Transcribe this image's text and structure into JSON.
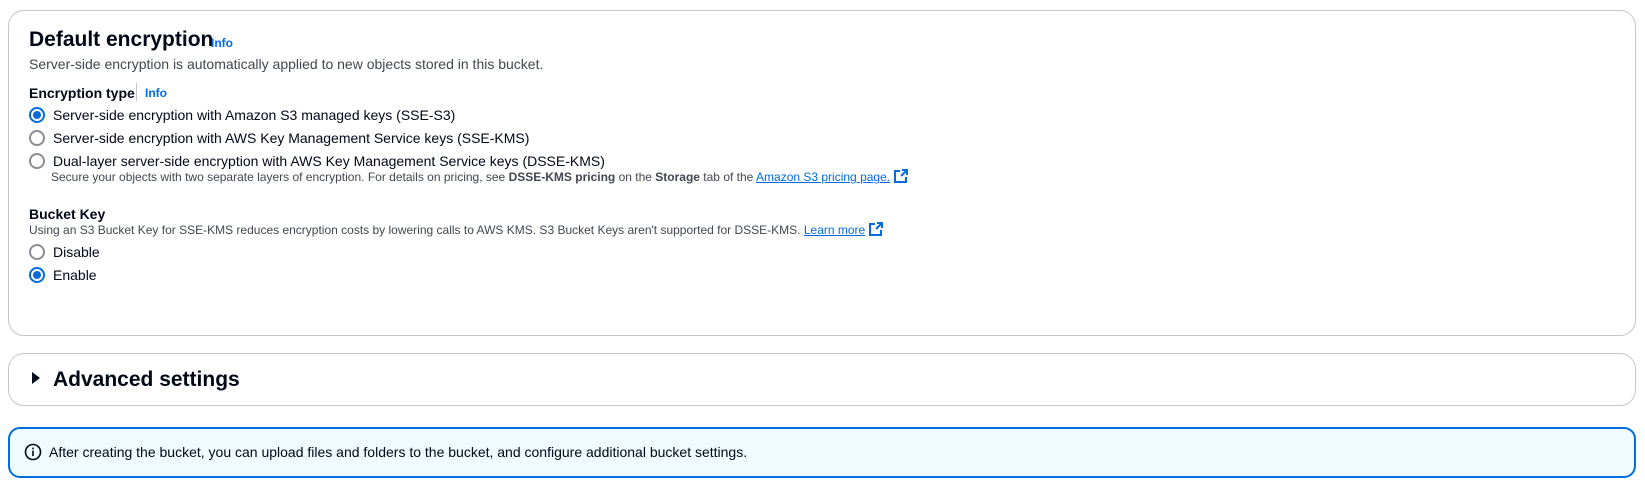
{
  "encryption": {
    "title": "Default encryption",
    "info_label": "Info",
    "description": "Server-side encryption is automatically applied to new objects stored in this bucket.",
    "type_label": "Encryption type",
    "type_info_label": "Info",
    "options": [
      {
        "label": "Server-side encryption with Amazon S3 managed keys (SSE-S3)",
        "checked": true
      },
      {
        "label": "Server-side encryption with AWS Key Management Service keys (SSE-KMS)",
        "checked": false
      },
      {
        "label": "Dual-layer server-side encryption with AWS Key Management Service keys (DSSE-KMS)",
        "checked": false
      }
    ],
    "dsse_desc_prefix": "Secure your objects with two separate layers of encryption. For details on pricing, see ",
    "dsse_desc_bold1": "DSSE-KMS pricing",
    "dsse_desc_mid": " on the ",
    "dsse_desc_bold2": "Storage",
    "dsse_desc_suffix": " tab of the ",
    "dsse_link": "Amazon S3 pricing page.",
    "bucket_key_label": "Bucket Key",
    "bucket_key_desc": "Using an S3 Bucket Key for SSE-KMS reduces encryption costs by lowering calls to AWS KMS. S3 Bucket Keys aren't supported for DSSE-KMS. ",
    "bucket_key_link": "Learn more",
    "bucket_key_options": [
      {
        "label": "Disable",
        "checked": false
      },
      {
        "label": "Enable",
        "checked": true
      }
    ]
  },
  "advanced": {
    "title": "Advanced settings",
    "expanded": false
  },
  "flash": {
    "text": "After creating the bucket, you can upload files and folders to the bucket, and configure additional bucket settings."
  },
  "colors": {
    "accent": "#006ce0",
    "info_bg": "#f0fbff",
    "border": "#c6c6cd"
  },
  "icons": {
    "external": "external-link-icon",
    "caret": "caret-right-icon",
    "info": "info-circle-icon"
  }
}
